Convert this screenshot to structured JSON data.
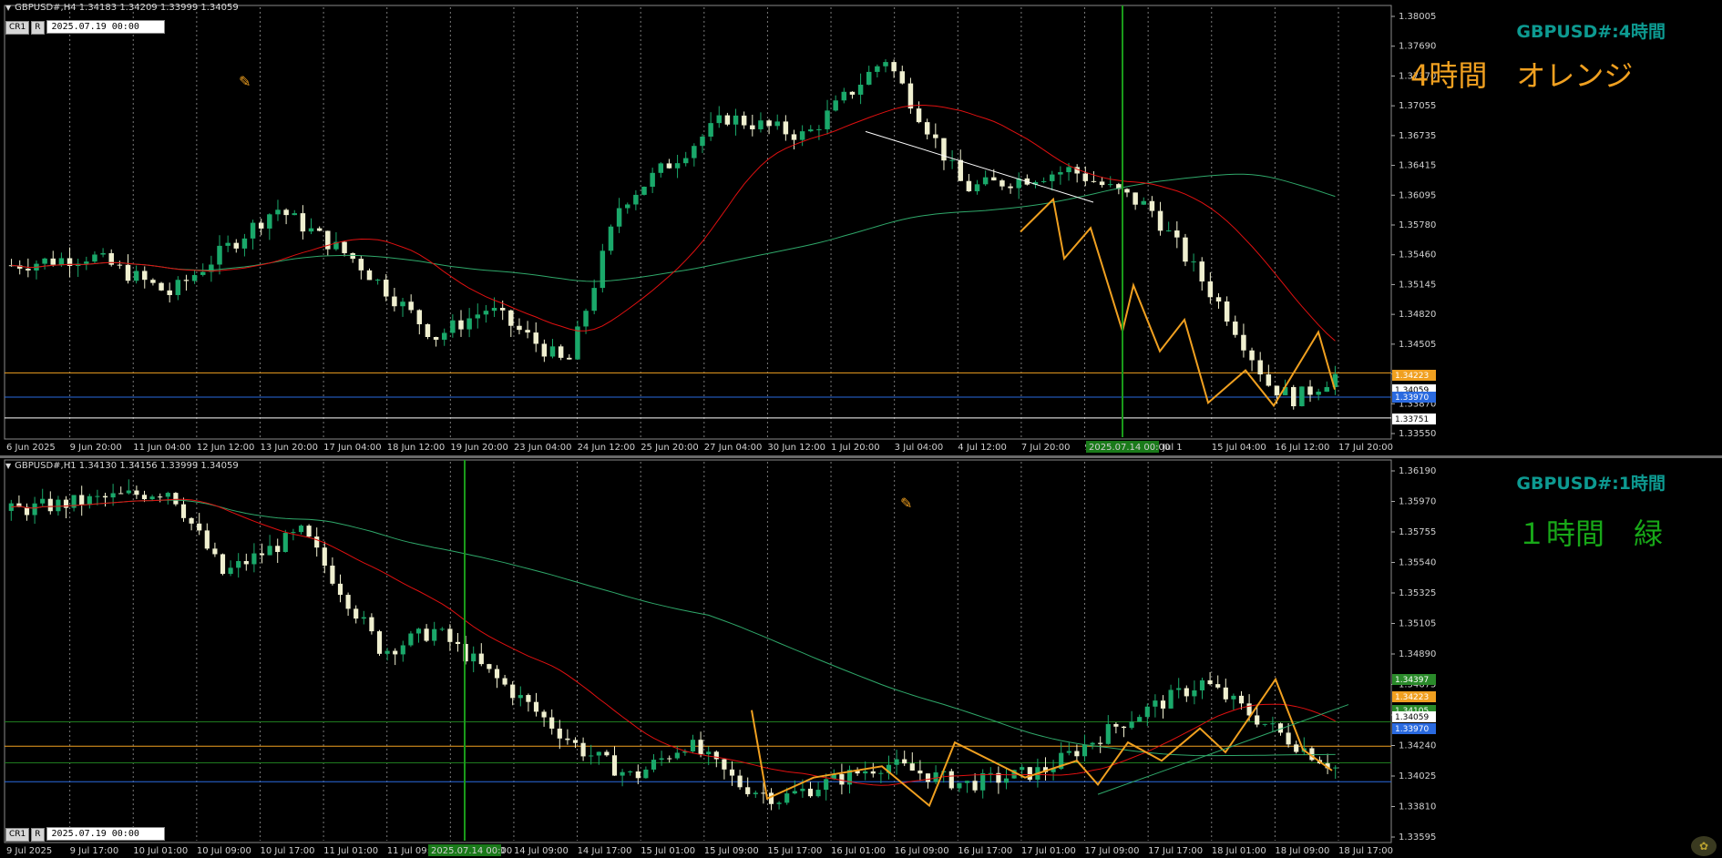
{
  "colors": {
    "bull": "#1aa86a",
    "bear": "#f0f0d0",
    "ma_fast": "#e01010",
    "ma_slow": "#2fa86a",
    "zigzag": "#f0a020",
    "grid": "#7a7a7a",
    "tf_title": "#0d9a91",
    "orange_label": "#f0a020",
    "green_label": "#18a818",
    "vline": "#1a9a1a"
  },
  "top_chart": {
    "header": "GBPUSD#,H4  1.34183 1.34209 1.33999 1.34059",
    "info_cr": "CR1",
    "info_r": "R",
    "info_date": "2025.07.19 00:00",
    "title": "GBPUSD#:4時間",
    "label": "4時間　オレンジ",
    "price_ticks": [
      "1.38005",
      "1.37690",
      "1.37370",
      "1.37055",
      "1.36735",
      "1.36415",
      "1.36095",
      "1.35780",
      "1.35460",
      "1.35145",
      "1.34820",
      "1.34505",
      "1.34190",
      "1.33870",
      "1.33550"
    ],
    "price_tags": [
      {
        "text": "1.34223",
        "color": "orange"
      },
      {
        "text": "1.34059",
        "color": "white"
      },
      {
        "text": "1.33970",
        "color": "blue"
      },
      {
        "text": "1.33751",
        "color": "white"
      }
    ],
    "time_ticks": [
      "6 Jun 2025",
      "9 Jun 20:00",
      "11 Jun 04:00",
      "12 Jun 12:00",
      "13 Jun 20:00",
      "17 Jun 04:00",
      "18 Jun 12:00",
      "19 Jun 20:00",
      "23 Jun 04:00",
      "24 Jun 12:00",
      "25 Jun 20:00",
      "27 Jun 04:00",
      "30 Jun 12:00",
      "1 Jul 20:00",
      "3 Jul 04:00",
      "4 Jul 12:00",
      "7 Jul 20:00",
      "9 Jul 04:00",
      "10 Jul 1",
      "15 Jul 04:00",
      "16 Jul 12:00",
      "17 Jul 20:00"
    ],
    "time_marker": "2025.07.14 00:00",
    "hlines": [
      {
        "price": 1.34223,
        "color": "orange"
      },
      {
        "price": 1.3397,
        "color": "blue"
      },
      {
        "price": 1.33751,
        "color": "white"
      }
    ]
  },
  "bottom_chart": {
    "header": "GBPUSD#,H1  1.34130 1.34156 1.33999 1.34059",
    "info_cr": "CR1",
    "info_r": "R",
    "info_date": "2025.07.19 00:00",
    "title": "GBPUSD#:1時間",
    "label": "１時間　緑",
    "price_ticks": [
      "1.36190",
      "1.35970",
      "1.35755",
      "1.35540",
      "1.35325",
      "1.35105",
      "1.34890",
      "1.34675",
      "1.34460",
      "1.34240",
      "1.34025",
      "1.33810",
      "1.33595"
    ],
    "price_tags": [
      {
        "text": "1.34397",
        "color": "green"
      },
      {
        "text": "1.34223",
        "color": "orange"
      },
      {
        "text": "1.34105",
        "color": "green"
      },
      {
        "text": "1.34059",
        "color": "white"
      },
      {
        "text": "1.33970",
        "color": "blue"
      }
    ],
    "time_ticks": [
      "9 Jul 2025",
      "9 Jul 17:00",
      "10 Jul 01:00",
      "10 Jul 09:00",
      "10 Jul 17:00",
      "11 Jul 01:00",
      "11 Jul 09:00",
      "11 Jul 17:00",
      "14 Jul 09:00",
      "14 Jul 17:00",
      "15 Jul 01:00",
      "15 Jul 09:00",
      "15 Jul 17:00",
      "16 Jul 01:00",
      "16 Jul 09:00",
      "16 Jul 17:00",
      "17 Jul 01:00",
      "17 Jul 09:00",
      "17 Jul 17:00",
      "18 Jul 01:00",
      "18 Jul 09:00",
      "18 Jul 17:00"
    ],
    "time_marker": "2025.07.14 00:00",
    "hlines": [
      {
        "price": 1.34397,
        "color": "green"
      },
      {
        "price": 1.34223,
        "color": "orange"
      },
      {
        "price": 1.34105,
        "color": "green"
      },
      {
        "price": 1.3397,
        "color": "blue"
      }
    ]
  }
}
